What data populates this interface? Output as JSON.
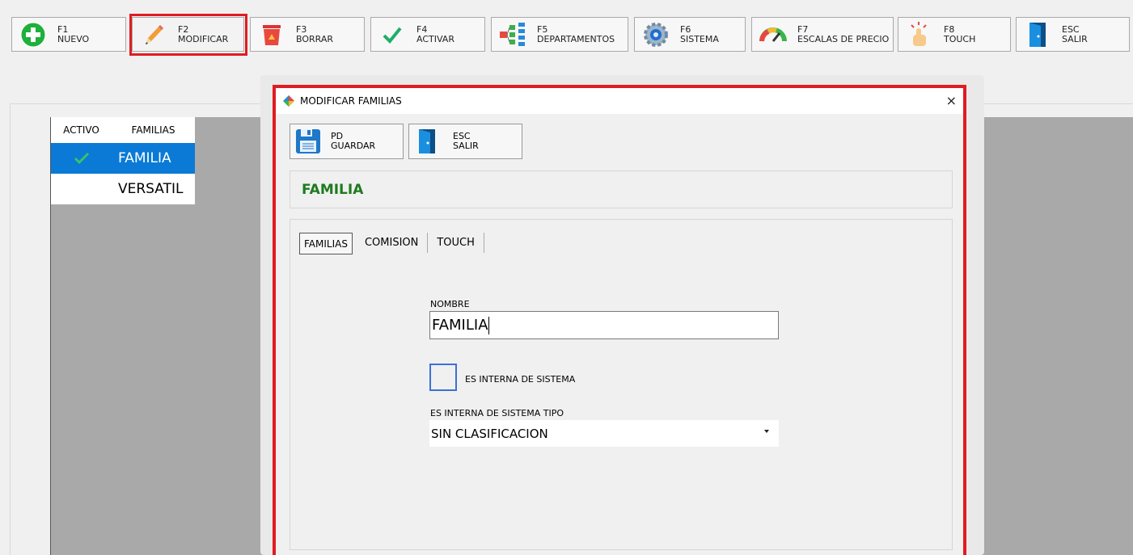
{
  "toolbar": [
    {
      "key": "F1",
      "label": "NUEVO",
      "icon": "add-icon"
    },
    {
      "key": "F2",
      "label": "MODIFICAR",
      "icon": "pencil-icon"
    },
    {
      "key": "F3",
      "label": "BORRAR",
      "icon": "trash-icon"
    },
    {
      "key": "F4",
      "label": "ACTIVAR",
      "icon": "check-icon"
    },
    {
      "key": "F5",
      "label": "DEPARTAMENTOS",
      "icon": "hierarchy-icon"
    },
    {
      "key": "F6",
      "label": "SISTEMA",
      "icon": "gear-icon"
    },
    {
      "key": "F7",
      "label": "ESCALAS DE PRECIO",
      "icon": "gauge-icon"
    },
    {
      "key": "F8",
      "label": "TOUCH",
      "icon": "touch-icon"
    },
    {
      "key": "ESC",
      "label": "SALIR",
      "icon": "door-icon"
    }
  ],
  "grid": {
    "headers": {
      "activo": "ACTIVO",
      "familias": "FAMILIAS"
    },
    "rows": [
      {
        "active": true,
        "name": "FAMILIA"
      },
      {
        "active": false,
        "name": "VERSATIL"
      }
    ]
  },
  "dialog": {
    "title": "MODIFICAR FAMILIAS",
    "close": "×",
    "buttons": [
      {
        "key": "PD",
        "label": "GUARDAR",
        "icon": "save-icon"
      },
      {
        "key": "ESC",
        "label": "SALIR",
        "icon": "door-icon"
      }
    ],
    "header_name": "FAMILIA",
    "tabs": [
      "FAMILIAS",
      "COMISION",
      "TOUCH"
    ],
    "form": {
      "nombre_label": "NOMBRE",
      "nombre_value": "FAMILIA",
      "checkbox_label": "ES INTERNA DE SISTEMA",
      "checkbox_checked": false,
      "tipo_label": "ES INTERNA DE SISTEMA TIPO",
      "tipo_value": "SIN CLASIFICACION"
    }
  },
  "colors": {
    "highlight": "#e11b22",
    "accent_green": "#1f7a1f",
    "selection": "#0a7ad6"
  }
}
